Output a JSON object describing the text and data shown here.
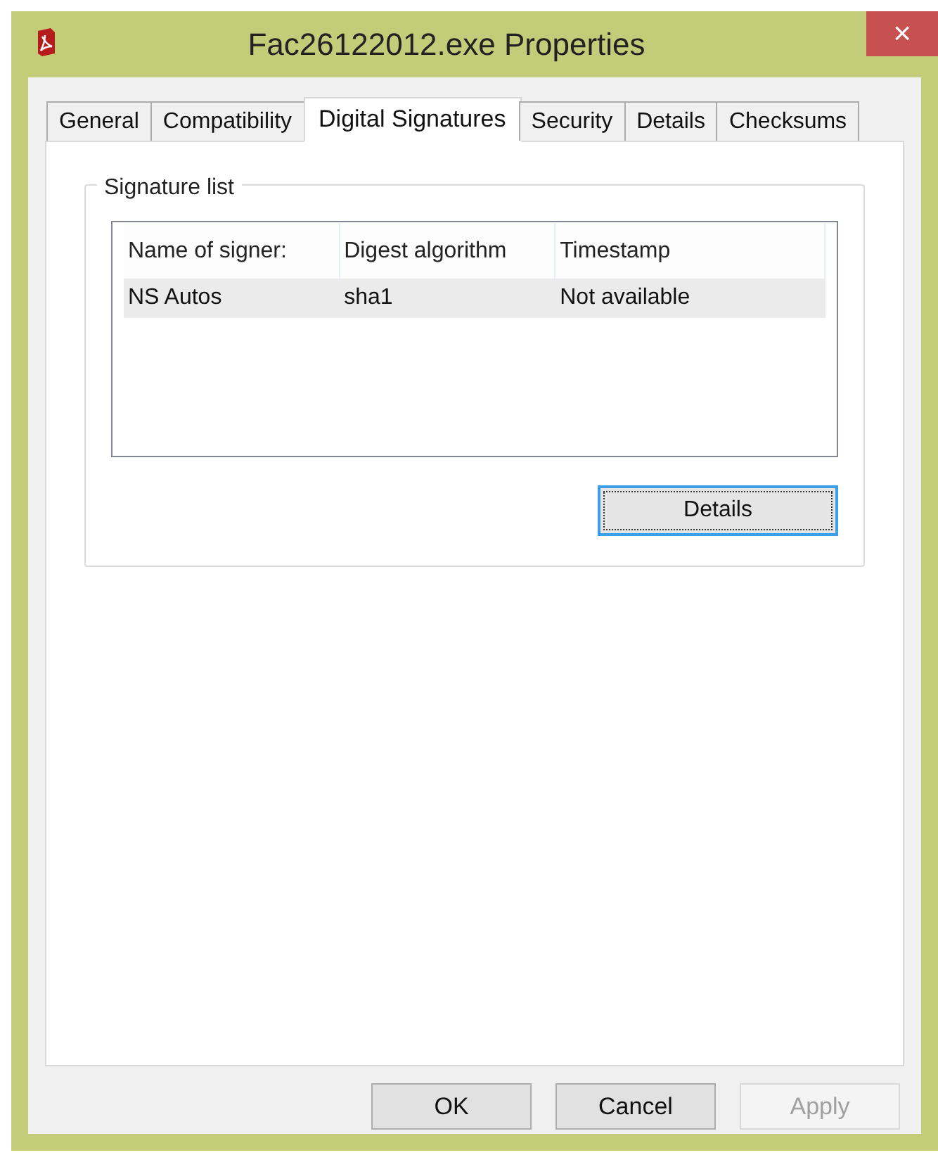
{
  "window": {
    "title": "Fac26122012.exe Properties",
    "close": "×"
  },
  "tabs": [
    {
      "label": "General",
      "selected": false
    },
    {
      "label": "Compatibility",
      "selected": false
    },
    {
      "label": "Digital Signatures",
      "selected": true
    },
    {
      "label": "Security",
      "selected": false
    },
    {
      "label": "Details",
      "selected": false
    },
    {
      "label": "Checksums",
      "selected": false
    }
  ],
  "signature_list": {
    "title": "Signature list",
    "columns": [
      "Name of signer:",
      "Digest algorithm",
      "Timestamp"
    ],
    "rows": [
      {
        "cells": [
          "NS Autos",
          "sha1",
          "Not available"
        ],
        "selected": true
      }
    ],
    "details_button": {
      "label": "Details",
      "focused": true
    }
  },
  "buttons": [
    {
      "label": "OK",
      "disabled": false
    },
    {
      "label": "Cancel",
      "disabled": false
    },
    {
      "label": "Apply",
      "disabled": true
    }
  ]
}
